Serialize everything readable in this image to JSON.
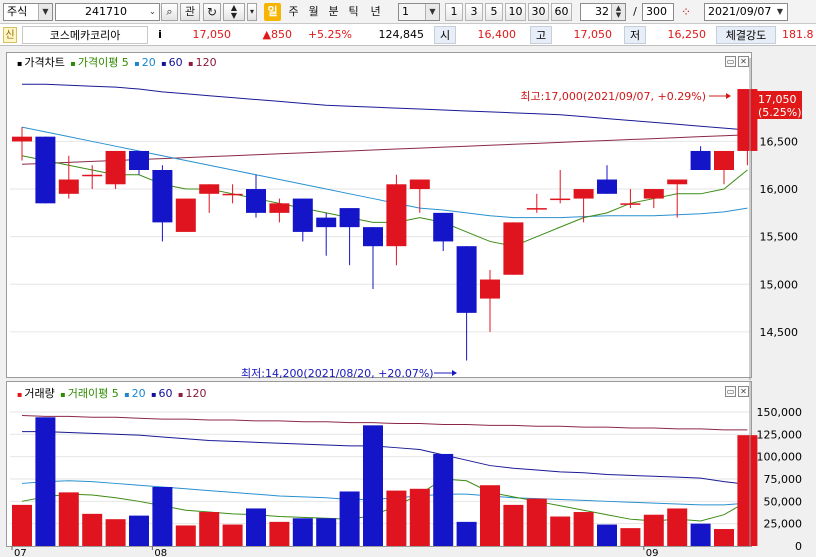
{
  "toolbar": {
    "market_type": "주식",
    "stock_code": "241710",
    "relation_label": "관",
    "period_tabs": [
      "일",
      "주",
      "월",
      "분",
      "틱",
      "년"
    ],
    "active_period": "일",
    "interval_value": "1",
    "interval_buttons": [
      "1",
      "3",
      "5",
      "10",
      "30",
      "60"
    ],
    "view_count": "32",
    "separator": "/",
    "total_count": "300",
    "date": "2021/09/07"
  },
  "quote": {
    "credit_badge": "신",
    "stock_name": "코스메카코리아",
    "info_icon": "i",
    "price": "17,050",
    "change": "▲850",
    "change_pct": "+5.25%",
    "volume": "124,845",
    "open_label": "시",
    "open": "16,400",
    "high_label": "고",
    "high": "17,050",
    "low_label": "저",
    "low": "16,250",
    "strength_label": "체결강도",
    "strength": "181.8"
  },
  "price_panel": {
    "legend": [
      {
        "text": "가격차트",
        "color": "#000000"
      },
      {
        "text": "가격이평 5",
        "color": "#2e8b00"
      },
      {
        "text": "20",
        "color": "#1c86d0"
      },
      {
        "text": "60",
        "color": "#10109a"
      },
      {
        "text": "120",
        "color": "#8c1a3a"
      }
    ],
    "annot_high": "최고:17,000(2021/09/07, +0.29%)",
    "annot_low": "최저:14,200(2021/08/20, +20.07%)",
    "current_tag_price": "17,050",
    "current_tag_pct": "(5.25%)",
    "y_labels": [
      "16,500",
      "16,000",
      "15,500",
      "15,000",
      "14,500"
    ]
  },
  "volume_panel": {
    "legend": [
      {
        "text": "거래량",
        "color": "#000000"
      },
      {
        "text": "거래이평 5",
        "color": "#2e8b00"
      },
      {
        "text": "20",
        "color": "#1c86d0"
      },
      {
        "text": "60",
        "color": "#10109a"
      },
      {
        "text": "120",
        "color": "#8c1a3a"
      }
    ],
    "y_labels": [
      "150,000",
      "125,000",
      "100,000",
      "75,000",
      "50,000",
      "25,000",
      "0"
    ]
  },
  "x_labels": [
    "07",
    "08",
    "09"
  ],
  "colors": {
    "up": "#e0141e",
    "down": "#1414c8",
    "ma5": "#3c8c14",
    "ma20": "#2890d0",
    "ma60": "#1a1a96",
    "ma120": "#8c2846"
  },
  "chart_data": {
    "type": "candlestick",
    "price": {
      "ylim": [
        14100,
        17250
      ],
      "candles": [
        {
          "o": 16500,
          "h": 16650,
          "l": 16300,
          "c": 16550
        },
        {
          "o": 16550,
          "h": 16550,
          "l": 15850,
          "c": 15850
        },
        {
          "o": 15950,
          "h": 16350,
          "l": 15900,
          "c": 16100
        },
        {
          "o": 16150,
          "h": 16250,
          "l": 16000,
          "c": 16150
        },
        {
          "o": 16050,
          "h": 16400,
          "l": 16000,
          "c": 16400
        },
        {
          "o": 16400,
          "h": 16400,
          "l": 16150,
          "c": 16200
        },
        {
          "o": 16200,
          "h": 16250,
          "l": 15450,
          "c": 15650
        },
        {
          "o": 15550,
          "h": 15900,
          "l": 15550,
          "c": 15900
        },
        {
          "o": 15950,
          "h": 16050,
          "l": 15750,
          "c": 16050
        },
        {
          "o": 15950,
          "h": 16050,
          "l": 15850,
          "c": 15950
        },
        {
          "o": 16000,
          "h": 16150,
          "l": 15700,
          "c": 15750
        },
        {
          "o": 15750,
          "h": 15900,
          "l": 15650,
          "c": 15850
        },
        {
          "o": 15900,
          "h": 15900,
          "l": 15450,
          "c": 15550
        },
        {
          "o": 15700,
          "h": 15750,
          "l": 15300,
          "c": 15600
        },
        {
          "o": 15800,
          "h": 15800,
          "l": 15200,
          "c": 15600
        },
        {
          "o": 15600,
          "h": 15600,
          "l": 14950,
          "c": 15400
        },
        {
          "o": 15400,
          "h": 16150,
          "l": 15200,
          "c": 16050
        },
        {
          "o": 16000,
          "h": 16100,
          "l": 15750,
          "c": 16100
        },
        {
          "o": 15750,
          "h": 15750,
          "l": 15350,
          "c": 15450
        },
        {
          "o": 15400,
          "h": 15400,
          "l": 14200,
          "c": 14700
        },
        {
          "o": 14850,
          "h": 15150,
          "l": 14500,
          "c": 15050
        },
        {
          "o": 15100,
          "h": 15650,
          "l": 15100,
          "c": 15650
        },
        {
          "o": 15800,
          "h": 15950,
          "l": 15750,
          "c": 15800
        },
        {
          "o": 15900,
          "h": 16200,
          "l": 15850,
          "c": 15900
        },
        {
          "o": 15900,
          "h": 16000,
          "l": 15650,
          "c": 16000
        },
        {
          "o": 16100,
          "h": 16250,
          "l": 15950,
          "c": 15950
        },
        {
          "o": 15850,
          "h": 16000,
          "l": 15800,
          "c": 15850
        },
        {
          "o": 15900,
          "h": 16000,
          "l": 15800,
          "c": 16000
        },
        {
          "o": 16050,
          "h": 16050,
          "l": 15700,
          "c": 16100
        },
        {
          "o": 16400,
          "h": 16450,
          "l": 16200,
          "c": 16200
        },
        {
          "o": 16200,
          "h": 16300,
          "l": 16050,
          "c": 16400
        },
        {
          "o": 16400,
          "h": 17050,
          "l": 16250,
          "c": 17050
        }
      ],
      "ma5": [
        16350,
        16300,
        16250,
        16200,
        16150,
        16150,
        16050,
        16000,
        16000,
        15950,
        15900,
        15850,
        15800,
        15750,
        15700,
        15650,
        15650,
        15700,
        15650,
        15550,
        15450,
        15400,
        15500,
        15600,
        15700,
        15750,
        15850,
        15900,
        15950,
        15950,
        16000,
        16200
      ],
      "ma20": [
        16650,
        16600,
        16550,
        16500,
        16450,
        16400,
        16350,
        16300,
        16250,
        16200,
        16150,
        16100,
        16050,
        16000,
        15950,
        15900,
        15850,
        15800,
        15780,
        15750,
        15720,
        15700,
        15700,
        15700,
        15710,
        15720,
        15720,
        15720,
        15730,
        15740,
        15760,
        15800
      ],
      "ma60": [
        17100,
        17100,
        17090,
        17080,
        17070,
        17050,
        17020,
        17000,
        16980,
        16960,
        16940,
        16920,
        16900,
        16880,
        16870,
        16860,
        16850,
        16840,
        16830,
        16820,
        16810,
        16800,
        16790,
        16780,
        16760,
        16740,
        16720,
        16700,
        16680,
        16660,
        16640,
        16620
      ],
      "ma120": [
        16260,
        16270,
        16280,
        16290,
        16300,
        16310,
        16320,
        16330,
        16340,
        16350,
        16360,
        16370,
        16380,
        16390,
        16400,
        16410,
        16420,
        16430,
        16440,
        16450,
        16460,
        16470,
        16480,
        16490,
        16500,
        16510,
        16520,
        16530,
        16540,
        16550,
        16560,
        16570
      ]
    },
    "volume": {
      "ylim": [
        0,
        160000
      ],
      "values": [
        46000,
        144000,
        60000,
        36000,
        30000,
        34000,
        66000,
        23000,
        38000,
        24000,
        42000,
        27000,
        31000,
        31000,
        61000,
        135000,
        62000,
        64000,
        103000,
        27000,
        68000,
        46000,
        53000,
        33000,
        38000,
        24000,
        20000,
        35000,
        42000,
        25000,
        19000,
        124000
      ],
      "ma5": [
        50000,
        55000,
        58000,
        57000,
        54000,
        50000,
        45000,
        40000,
        38000,
        36000,
        35000,
        33000,
        32000,
        31000,
        30000,
        34000,
        45000,
        58000,
        75000,
        73000,
        60000,
        55000,
        50000,
        45000,
        40000,
        35000,
        30000,
        28000,
        30000,
        28000,
        35000,
        50000
      ],
      "ma20": [
        70000,
        72000,
        73000,
        72000,
        70000,
        68000,
        66000,
        64000,
        62000,
        60000,
        58000,
        56000,
        55000,
        54000,
        52000,
        52000,
        54000,
        56000,
        58000,
        58000,
        56000,
        54000,
        53000,
        52000,
        51000,
        50000,
        49000,
        48000,
        47000,
        46000,
        46000,
        48000
      ],
      "ma60": [
        128000,
        128000,
        127000,
        126000,
        125000,
        124000,
        122000,
        120000,
        118000,
        117000,
        116000,
        115000,
        114000,
        113000,
        112000,
        112000,
        110000,
        108000,
        102000,
        96000,
        90000,
        87000,
        85000,
        83000,
        82000,
        80000,
        79000,
        78000,
        77000,
        76000,
        72000,
        69000
      ],
      "ma120": [
        146000,
        145000,
        145000,
        144000,
        144000,
        143000,
        142000,
        142000,
        141000,
        141000,
        140000,
        140000,
        139000,
        139000,
        138000,
        138000,
        137000,
        137000,
        136000,
        136000,
        135000,
        135000,
        134000,
        134000,
        133000,
        133000,
        132000,
        132000,
        131000,
        131000,
        130000,
        130000
      ]
    },
    "x_labels": [
      "07",
      "08",
      "09"
    ]
  }
}
